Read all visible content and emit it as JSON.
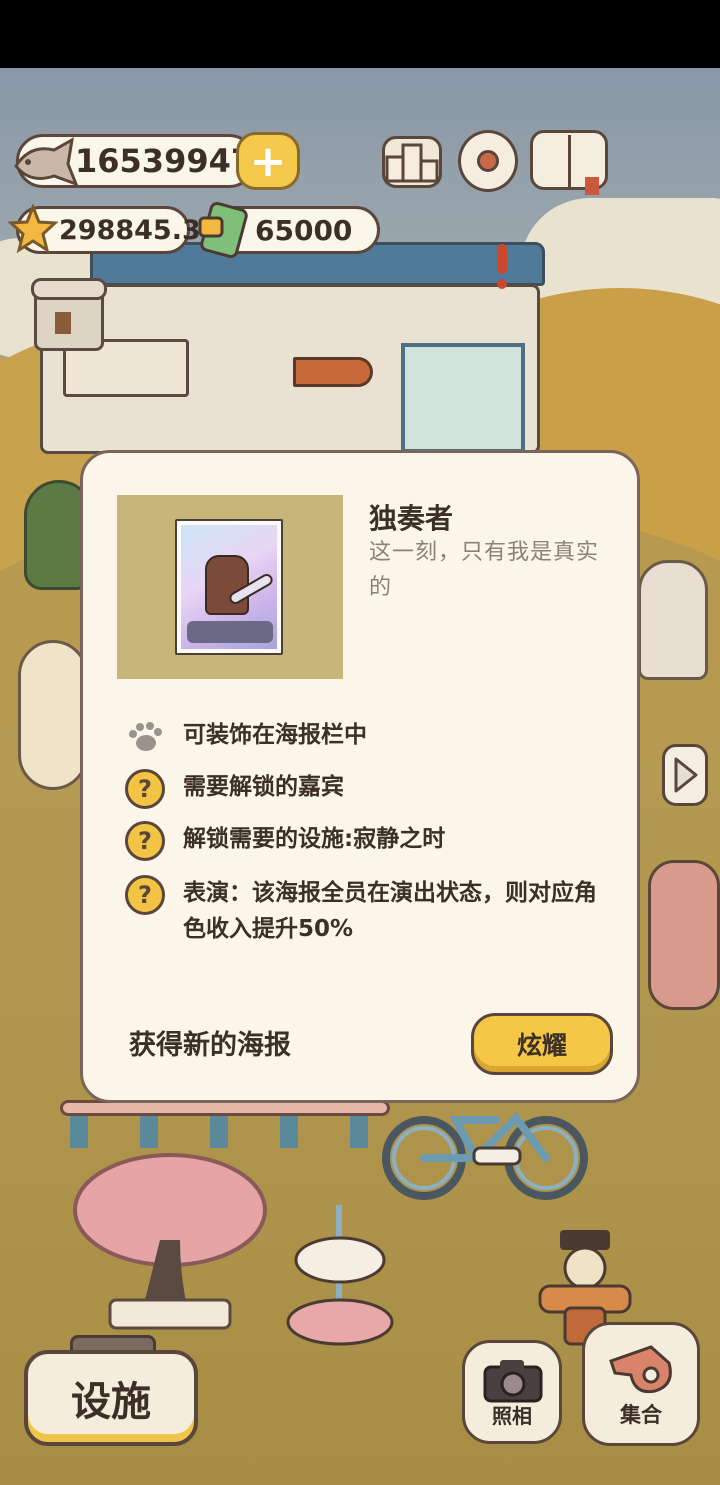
{
  "hud": {
    "fish_count": "16539947",
    "star_count": "298845.3",
    "ticket_count": "65000",
    "plus_label": "+",
    "fish_icon": "fish-icon",
    "star_icon": "star-icon",
    "ticket_icon": "ticket-icon"
  },
  "top_icons": {
    "ranking": "ranking-podium-icon",
    "settings": "gear-icon",
    "guide": "paw-book-icon"
  },
  "dialog": {
    "title": "独奏者",
    "subtitle": "这一刻，只有我是真实的",
    "features": [
      {
        "icon": "paw-icon",
        "text": "可装饰在海报栏中"
      },
      {
        "icon": "question-icon",
        "text": "需要解锁的嘉宾"
      },
      {
        "icon": "question-icon",
        "text": "解锁需要的设施:寂静之时"
      },
      {
        "icon": "question-icon",
        "text": "表演：该海报全员在演出状态，则对应角色收入提升50%"
      }
    ],
    "question_mark": "?",
    "footer_label": "获得新的海报",
    "show_button": "炫耀"
  },
  "bottom": {
    "facility_button": "设施",
    "photo_button": "照相",
    "gather_button": "集合"
  },
  "colors": {
    "accent_yellow": "#f6c646",
    "outline_brown": "#5a463a",
    "panel_cream": "#fcf6ea"
  }
}
